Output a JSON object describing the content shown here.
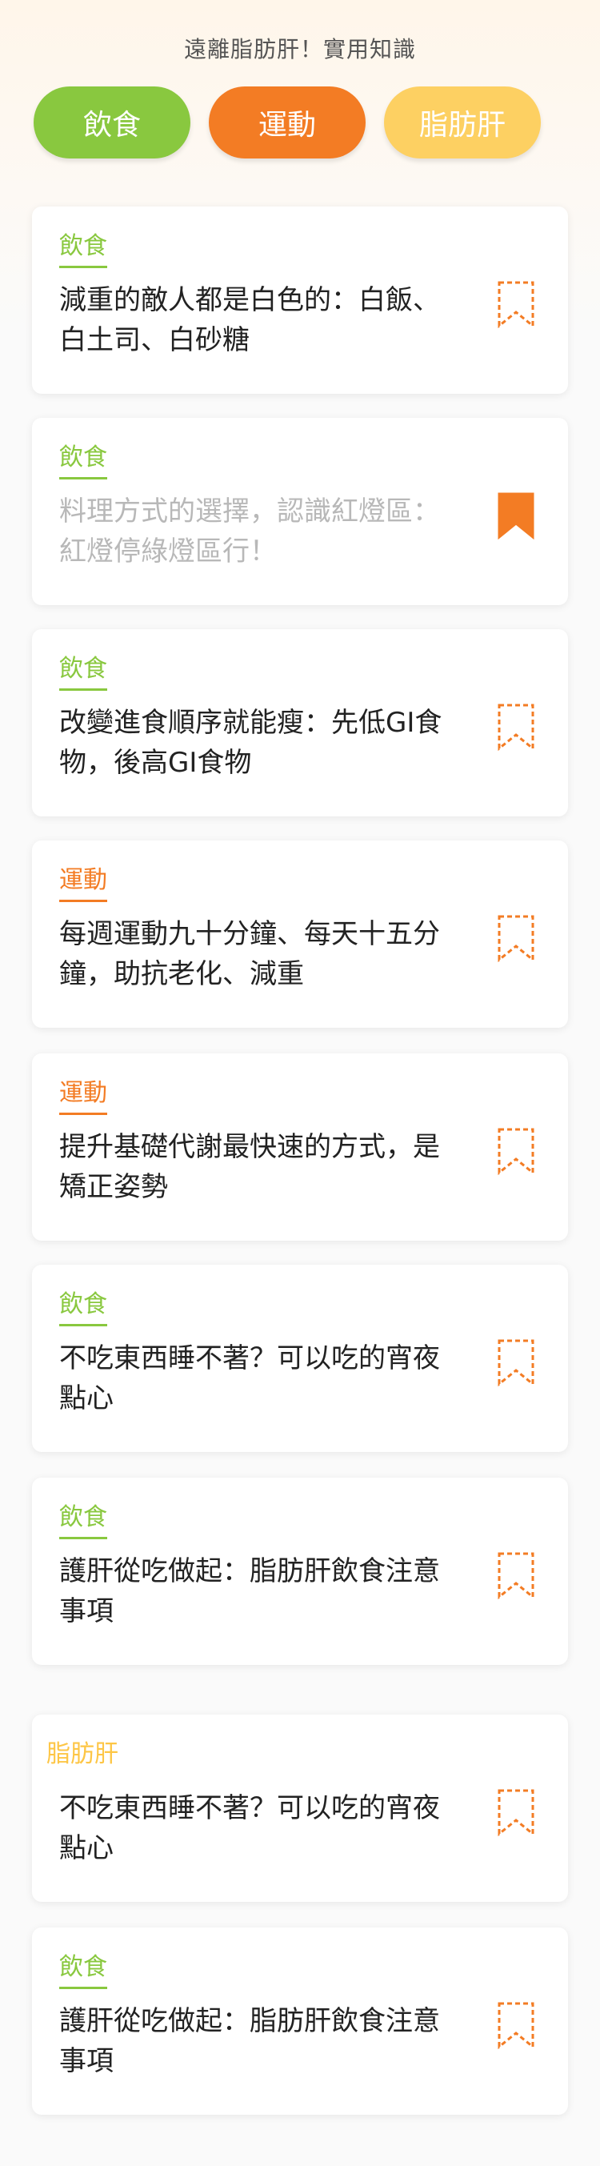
{
  "header": {
    "title": "遠離脂肪肝！實用知識"
  },
  "tabs": [
    {
      "label": "飲食"
    },
    {
      "label": "運動"
    },
    {
      "label": "脂肪肝"
    }
  ],
  "colors": {
    "diet": "#89c83f",
    "exercise": "#f37c24",
    "fatty_liver": "#fdd062",
    "bookmark": "#f37c24"
  },
  "articles": [
    {
      "category": "飲食",
      "title": "減重的敵人都是白色的：白飯、白土司、白砂糖",
      "bookmarked": false,
      "read": false
    },
    {
      "category": "飲食",
      "title": "料理方式的選擇，認識紅燈區：紅燈停綠燈區行！",
      "bookmarked": true,
      "read": true
    },
    {
      "category": "飲食",
      "title": "改變進食順序就能瘦：先低GI食物，後高GI食物",
      "bookmarked": false,
      "read": false
    },
    {
      "category": "運動",
      "title": "每週運動九十分鐘、每天十五分鐘，助抗老化、減重",
      "bookmarked": false,
      "read": false
    },
    {
      "category": "運動",
      "title": "提升基礎代謝最快速的方式，是矯正姿勢",
      "bookmarked": false,
      "read": false
    },
    {
      "category": "飲食",
      "title": "不吃東西睡不著？可以吃的宵夜點心",
      "bookmarked": false,
      "read": false
    },
    {
      "category": "飲食",
      "title": "護肝從吃做起：脂肪肝飲食注意事項",
      "bookmarked": false,
      "read": false
    },
    {
      "category": "脂肪肝",
      "title": "不吃東西睡不著？可以吃的宵夜點心",
      "bookmarked": false,
      "read": false
    },
    {
      "category": "飲食",
      "title": "護肝從吃做起：脂肪肝飲食注意事項",
      "bookmarked": false,
      "read": false
    }
  ]
}
